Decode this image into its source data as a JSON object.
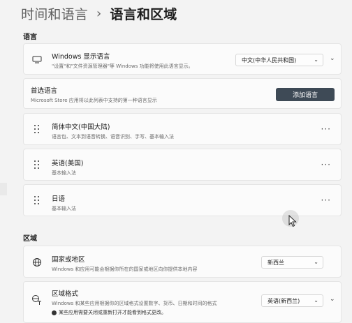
{
  "breadcrumb": {
    "parent": "时间和语言",
    "separator": "›",
    "current": "语言和区域"
  },
  "language_section": {
    "label": "语言",
    "display_language": {
      "title": "Windows 显示语言",
      "subtitle": "\"设置\"和\"文件资源管理器\"等 Windows 功能将使用此语言显示。",
      "value": "中文(中华人民共和国)"
    },
    "preferred": {
      "title": "首选语言",
      "subtitle": "Microsoft Store 应用将以此列表中支持的第一种语言显示",
      "button": "添加语言"
    },
    "languages": [
      {
        "name": "简体中文(中国大陆)",
        "features": "语言包、文本到语音转换、语音识别、手写、基本输入法"
      },
      {
        "name": "英语(美国)",
        "features": "基本输入法"
      },
      {
        "name": "日语",
        "features": "基本输入法"
      }
    ],
    "more_glyph": "···"
  },
  "region_section": {
    "label": "区域",
    "country": {
      "title": "国家或地区",
      "subtitle": "Windows 和应用可能会根据你所在的国家或地区向你提供本地内容",
      "value": "新西兰"
    },
    "format": {
      "title": "区域格式",
      "subtitle": "Windows 和某些应用根据你的区域格式设置数字、货币、日期和时间的格式",
      "note": "某些应用需要关闭或重新打开才能看到格式更改。",
      "value": "英语(新西兰)"
    }
  },
  "icons": [
    "monitor-icon",
    "drag-handle-icon",
    "more-icon",
    "globe-icon",
    "region-format-icon",
    "chevron-down-icon",
    "chevron-right-icon",
    "info-icon",
    "cursor-icon"
  ]
}
